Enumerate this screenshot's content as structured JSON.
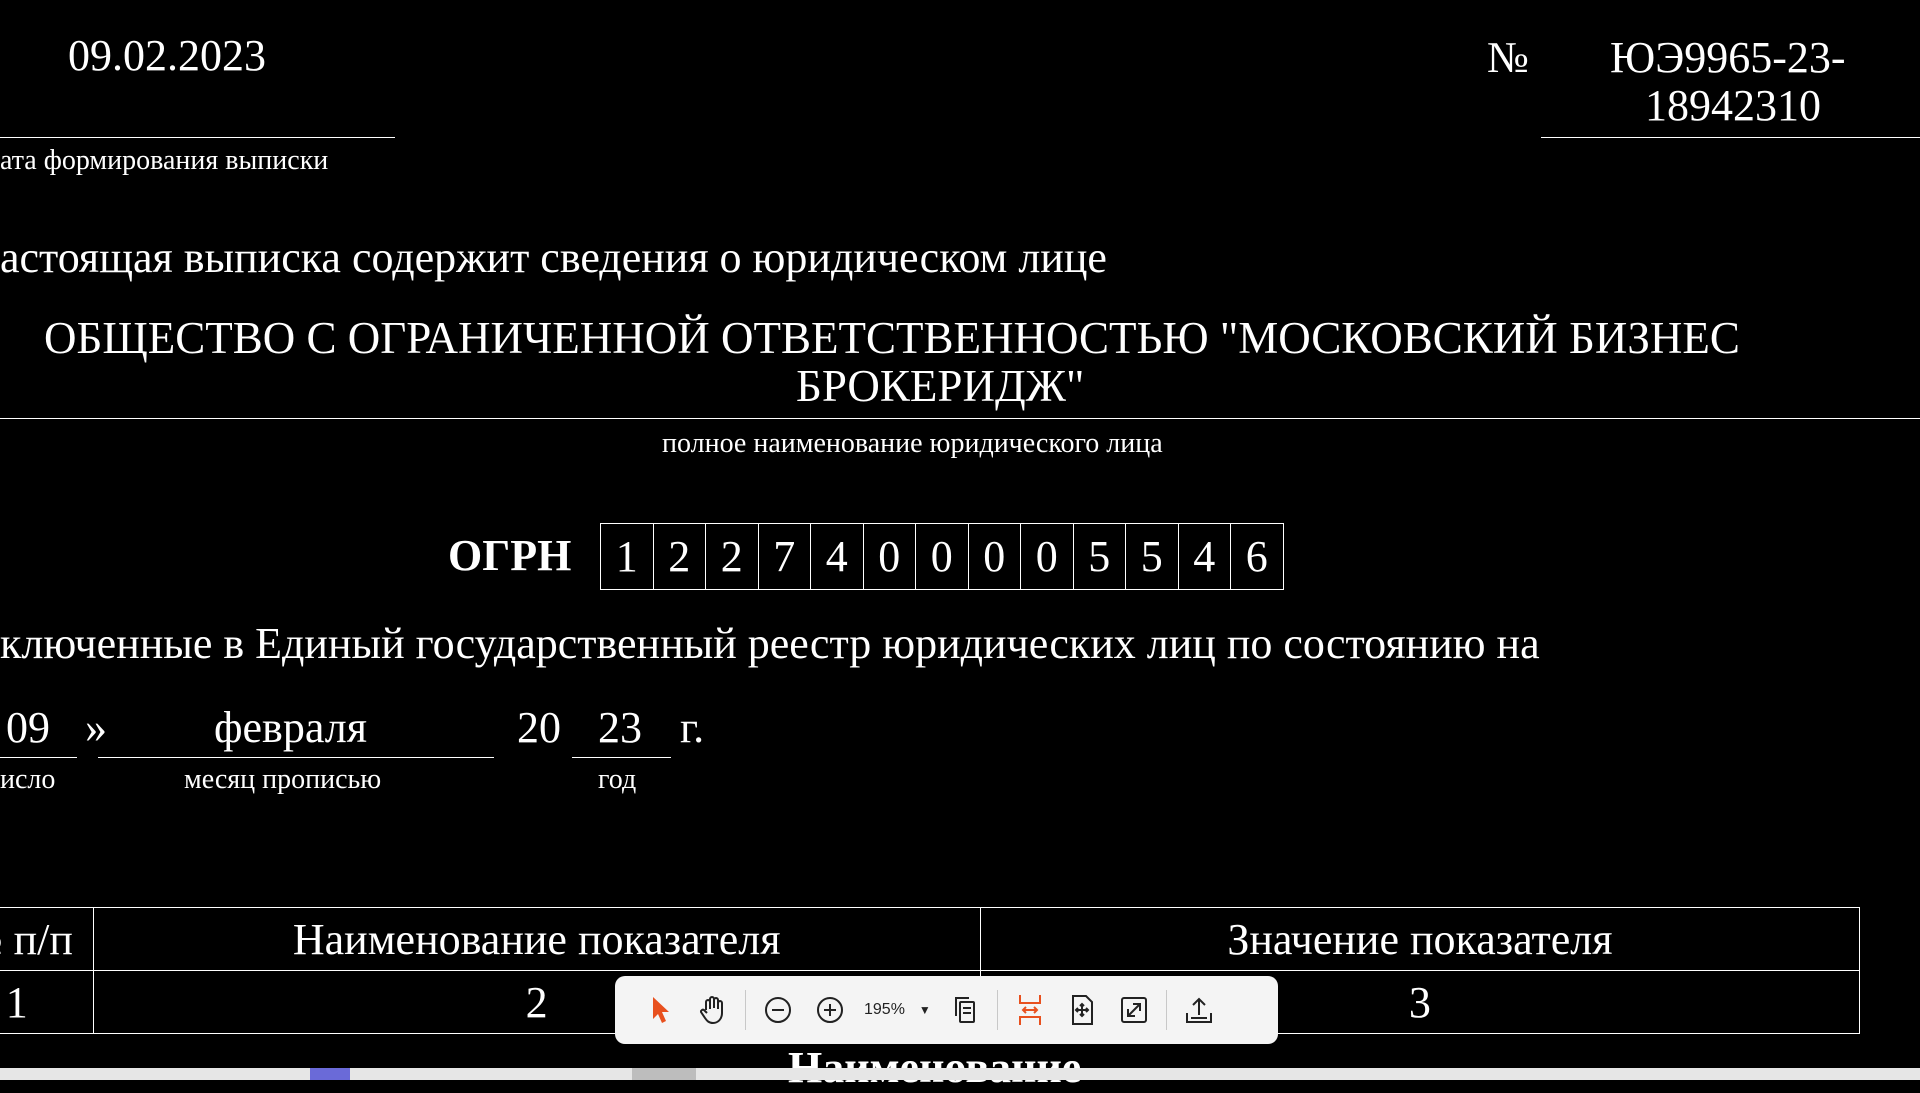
{
  "document": {
    "date": "09.02.2023",
    "date_caption": "ата формирования выписки",
    "number_sign": "№",
    "number_line1": "ЮЭ9965-23-",
    "number_line2": "18942310",
    "intro": "астоящая выписка содержит сведения о юридическом лице",
    "org_name_line1": "ОБЩЕСТВО С ОГРАНИЧЕННОЙ ОТВЕТСТВЕННОСТЬЮ \"МОСКОВСКИЙ БИЗНЕС",
    "org_name_line2": "БРОКЕРИДЖ\"",
    "org_name_caption": "полное наименование юридического лица",
    "ogrn_label": "ОГРН",
    "ogrn_digits": [
      "1",
      "2",
      "2",
      "7",
      "4",
      "0",
      "0",
      "0",
      "0",
      "5",
      "5",
      "4",
      "6"
    ],
    "included_text": "ключенные в Единый государственный реестр юридических лиц по состоянию на",
    "day": "09",
    "quote_close": "»",
    "month": "февраля",
    "century": "20",
    "year": "23",
    "year_suffix": "г.",
    "day_caption": "исло",
    "month_caption": "месяц прописью",
    "year_caption": "год",
    "table": {
      "headers": [
        "№ п/п",
        "Наименование показателя",
        "Значение показателя"
      ],
      "row1": [
        "1",
        "2",
        "3"
      ],
      "section_partial": "Наименование"
    }
  },
  "toolbar": {
    "zoom_value": "195%",
    "icons": [
      "select-arrow-icon",
      "hand-icon",
      "zoom-out-icon",
      "zoom-in-icon",
      "page-copy-icon",
      "fit-width-icon",
      "fit-page-icon",
      "fullscreen-icon",
      "share-icon"
    ],
    "accent_color": "#e8501e"
  }
}
